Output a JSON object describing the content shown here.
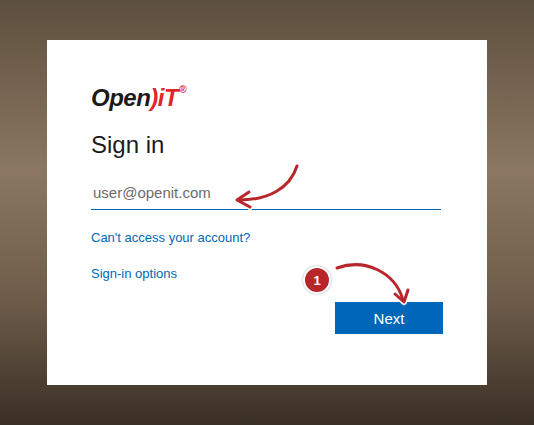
{
  "logo": [
    {
      "text": "Open",
      "color": "#1b1b1b"
    },
    {
      "text": ")iT",
      "color": "#e3242b"
    },
    {
      "text": "®",
      "color": "#e3242b"
    }
  ],
  "title": "Sign in",
  "email_field": {
    "placeholder": "user@openit.com",
    "focused": true
  },
  "links": [
    "Can't access your account?",
    "Sign-in options"
  ],
  "buttons": [
    {
      "label": "Next",
      "primary": true
    }
  ],
  "annotations": {
    "badge": "1"
  }
}
